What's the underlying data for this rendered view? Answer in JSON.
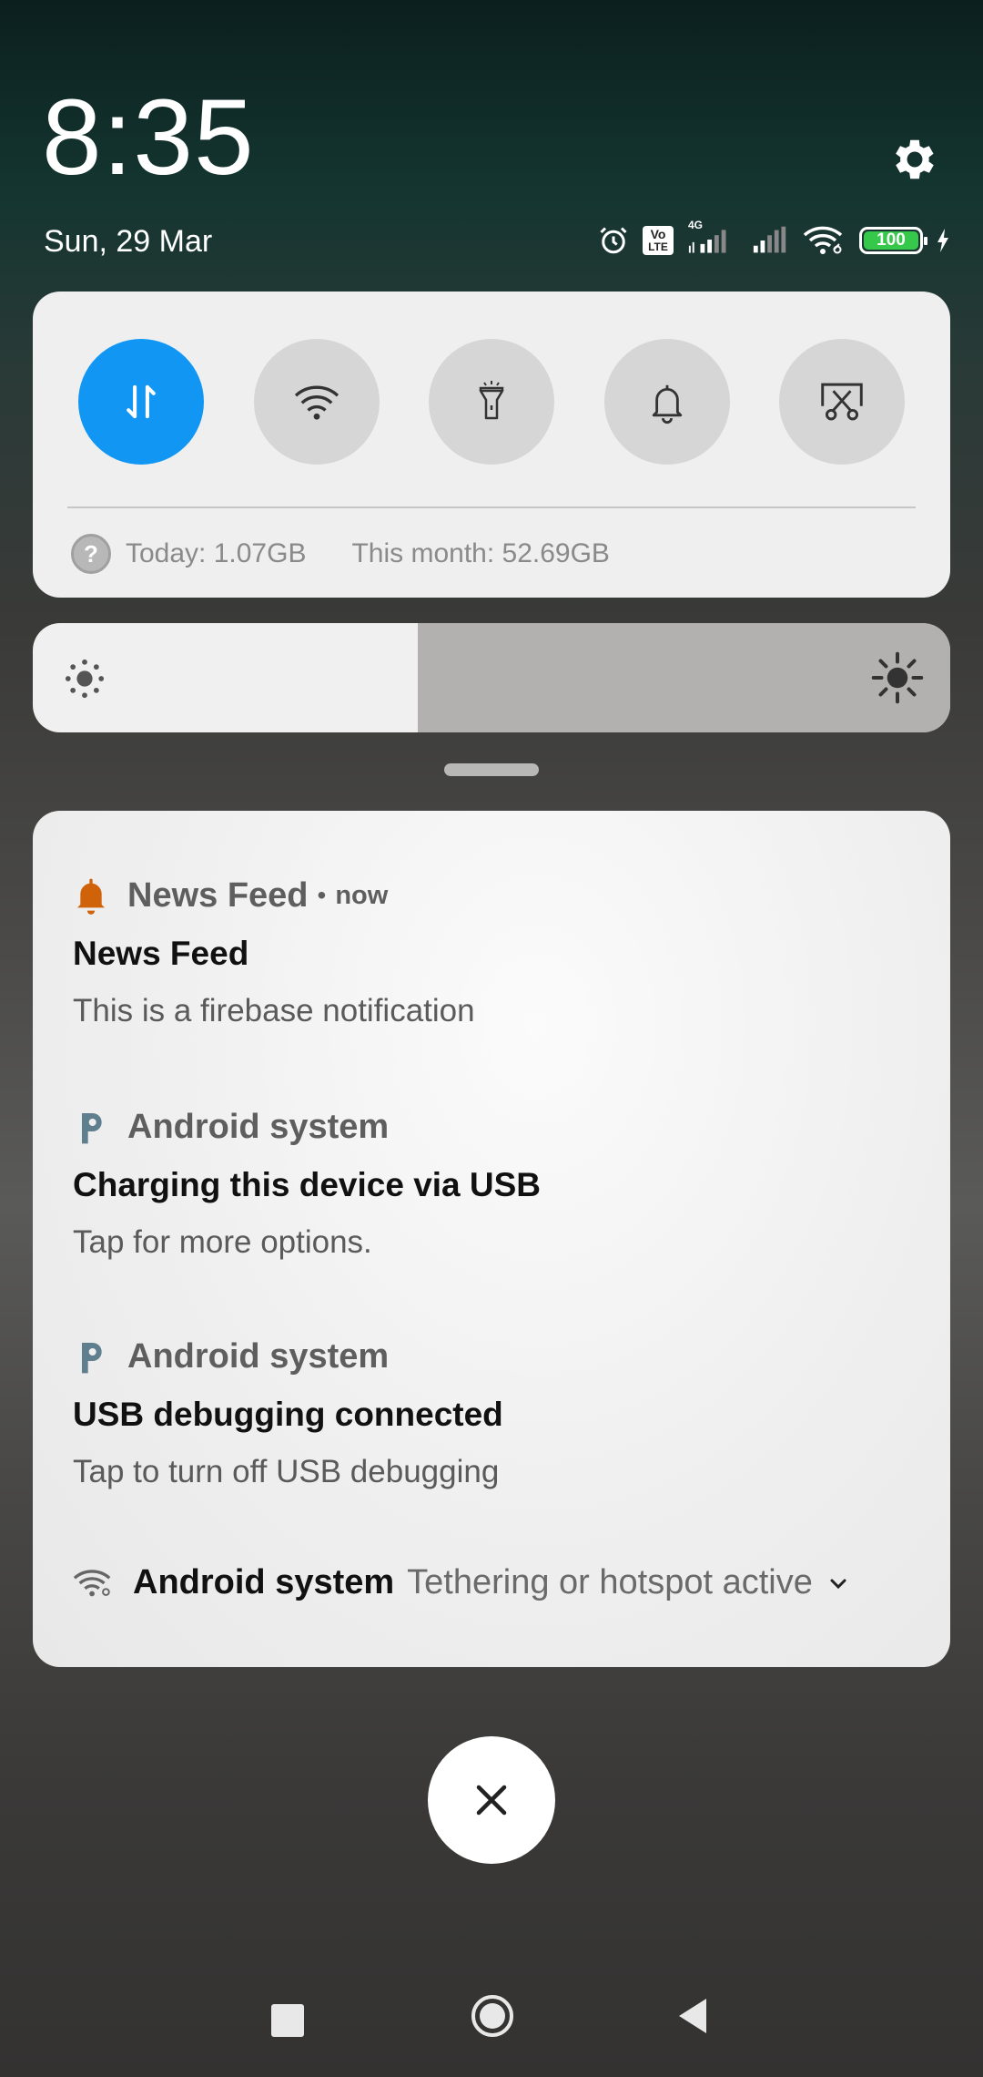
{
  "header": {
    "time": "8:35",
    "date": "Sun, 29 Mar",
    "battery_level": "100",
    "volte_top": "Vo",
    "volte_bottom": "LTE",
    "network_type": "4G"
  },
  "quick_settings": {
    "toggles": [
      {
        "name": "mobile-data",
        "active": true
      },
      {
        "name": "wifi",
        "active": false
      },
      {
        "name": "flashlight",
        "active": false
      },
      {
        "name": "notifications-sound",
        "active": false
      },
      {
        "name": "screenshot",
        "active": false
      }
    ],
    "data_usage": {
      "today": "Today: 1.07GB",
      "month": "This month: 52.69GB"
    },
    "brightness_level": 0.42
  },
  "notifications": [
    {
      "app": "News Feed",
      "time": "now",
      "title": "News Feed",
      "body": "This is a firebase notification",
      "icon": "bell-icon"
    },
    {
      "app": "Android system",
      "title": "Charging this device via USB",
      "body": "Tap for more options.",
      "icon": "android-system-icon"
    },
    {
      "app": "Android system",
      "title": "USB debugging connected",
      "body": "Tap to turn off USB debugging",
      "icon": "android-system-icon"
    },
    {
      "app": "Android system",
      "body": "Tethering or hotspot active",
      "icon": "hotspot-icon"
    }
  ],
  "colors": {
    "accent": "#1196f3",
    "bell": "#d0620a",
    "android_icon": "#5f7e8e"
  }
}
